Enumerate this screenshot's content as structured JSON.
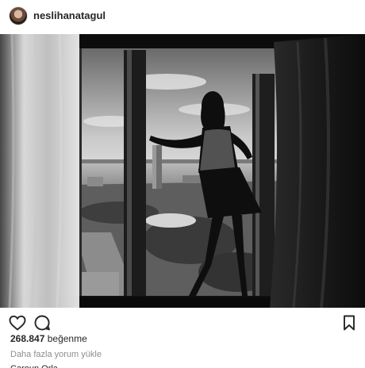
{
  "post": {
    "username": "neslihanatagul",
    "likes_count": "268.847",
    "likes_label": "beğenme",
    "load_more_comments": "Daha fazla yorum yükle",
    "partial_comment": "Caroun  Orla"
  },
  "icons": {
    "like": "heart-outline-icon",
    "comment": "speech-bubble-icon",
    "save": "bookmark-icon"
  }
}
